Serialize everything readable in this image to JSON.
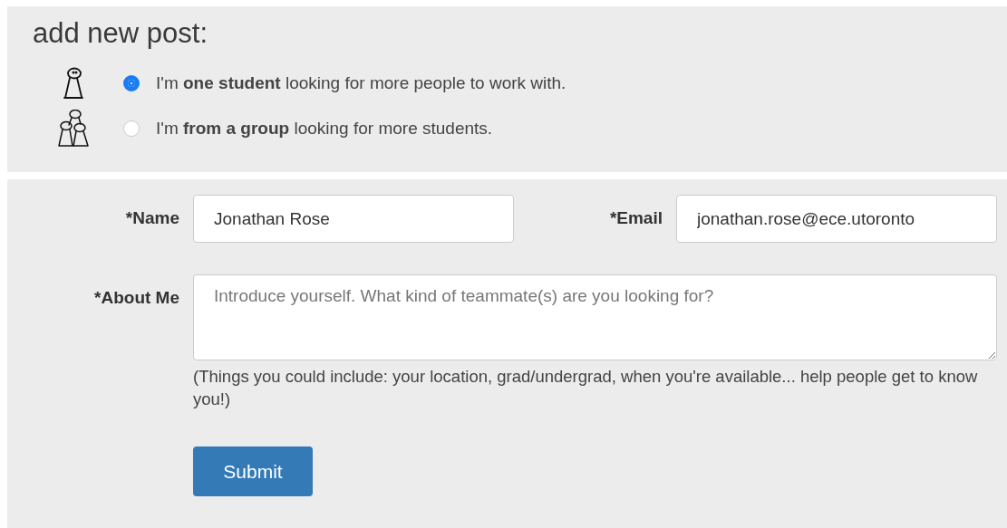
{
  "heading": "add new post:",
  "post_types": [
    {
      "kind": "single",
      "label": "I'm **one student** looking for more people to work with.",
      "selected": true
    },
    {
      "kind": "group",
      "label": "I'm **from a group** looking for more students.",
      "selected": false
    }
  ],
  "form": {
    "name": {
      "label": "*Name",
      "value": "Jonathan Rose"
    },
    "email": {
      "label": "*Email",
      "value": "jonathan.rose@ece.utoronto"
    },
    "about": {
      "label": "*About Me",
      "placeholder": "Introduce yourself. What kind of teammate(s) are you looking for?"
    },
    "hint": "(Things you could include: your location, grad/undergrad, when you're available... help people get to know you!)",
    "submit": "Submit"
  }
}
